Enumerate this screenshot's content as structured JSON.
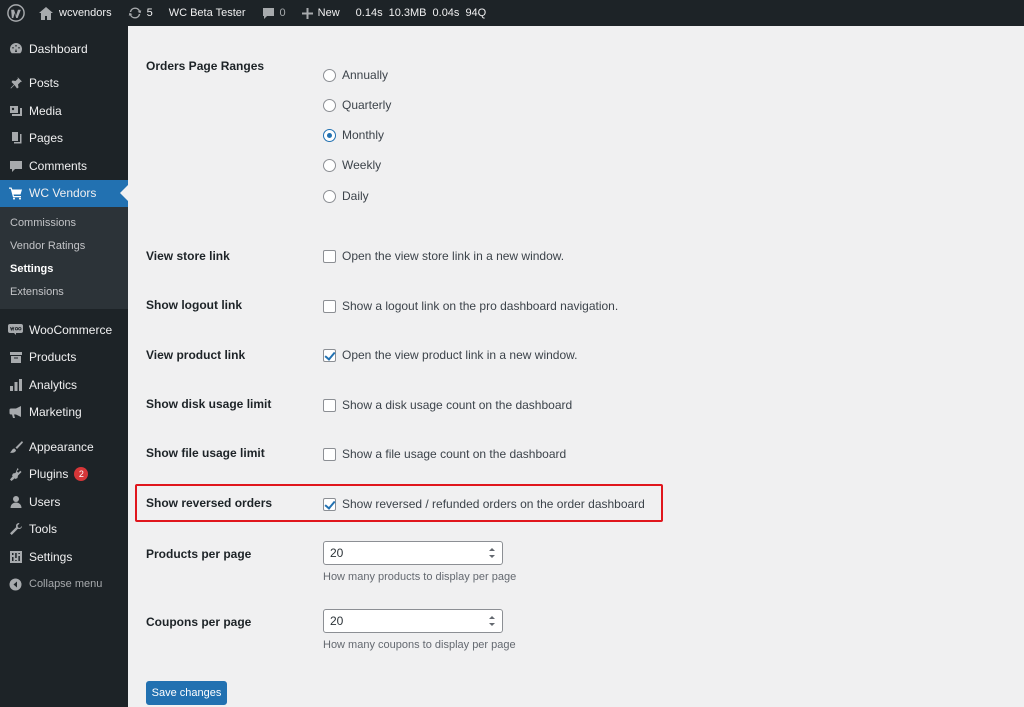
{
  "adminbar": {
    "site_name": "wcvendors",
    "updates_count": "5",
    "beta_tester": "WC Beta Tester",
    "comments_count": "0",
    "new_label": "New",
    "stats": [
      "0.14s",
      "10.3MB",
      "0.04s",
      "94Q"
    ]
  },
  "sidebar": {
    "dashboard": "Dashboard",
    "posts": "Posts",
    "media": "Media",
    "pages": "Pages",
    "comments": "Comments",
    "wc_vendors": "WC Vendors",
    "submenu": [
      "Commissions",
      "Vendor Ratings",
      "Settings",
      "Extensions"
    ],
    "woocommerce": "WooCommerce",
    "products": "Products",
    "analytics": "Analytics",
    "marketing": "Marketing",
    "appearance": "Appearance",
    "plugins": "Plugins",
    "plugins_badge": "2",
    "users": "Users",
    "tools": "Tools",
    "settings": "Settings",
    "collapse": "Collapse menu"
  },
  "settings": {
    "page_ranges": {
      "label": "Orders Page Ranges",
      "options": [
        "Annually",
        "Quarterly",
        "Monthly",
        "Weekly",
        "Daily"
      ],
      "selected": "Monthly"
    },
    "view_store_link": {
      "label": "View store link",
      "text": "Open the view store link in a new window.",
      "checked": false
    },
    "show_logout_link": {
      "label": "Show logout link",
      "text": "Show a logout link on the pro dashboard navigation.",
      "checked": false
    },
    "view_product_link": {
      "label": "View product link",
      "text": "Open the view product link in a new window.",
      "checked": true
    },
    "show_disk_usage": {
      "label": "Show disk usage limit",
      "text": "Show a disk usage count on the dashboard",
      "checked": false
    },
    "show_file_usage": {
      "label": "Show file usage limit",
      "text": "Show a file usage count on the dashboard",
      "checked": false
    },
    "show_reversed_orders": {
      "label": "Show reversed orders",
      "text": "Show reversed / refunded orders on the order dashboard",
      "checked": true
    },
    "products_per_page": {
      "label": "Products per page",
      "value": "20",
      "desc": "How many products to display per page"
    },
    "coupons_per_page": {
      "label": "Coupons per page",
      "value": "20",
      "desc": "How many coupons to display per page"
    },
    "save_label": "Save changes"
  },
  "colors": {
    "accent": "#2271b1",
    "sidebar_bg": "#1d2327",
    "highlight": "#e0161d",
    "badge": "#d63638"
  }
}
